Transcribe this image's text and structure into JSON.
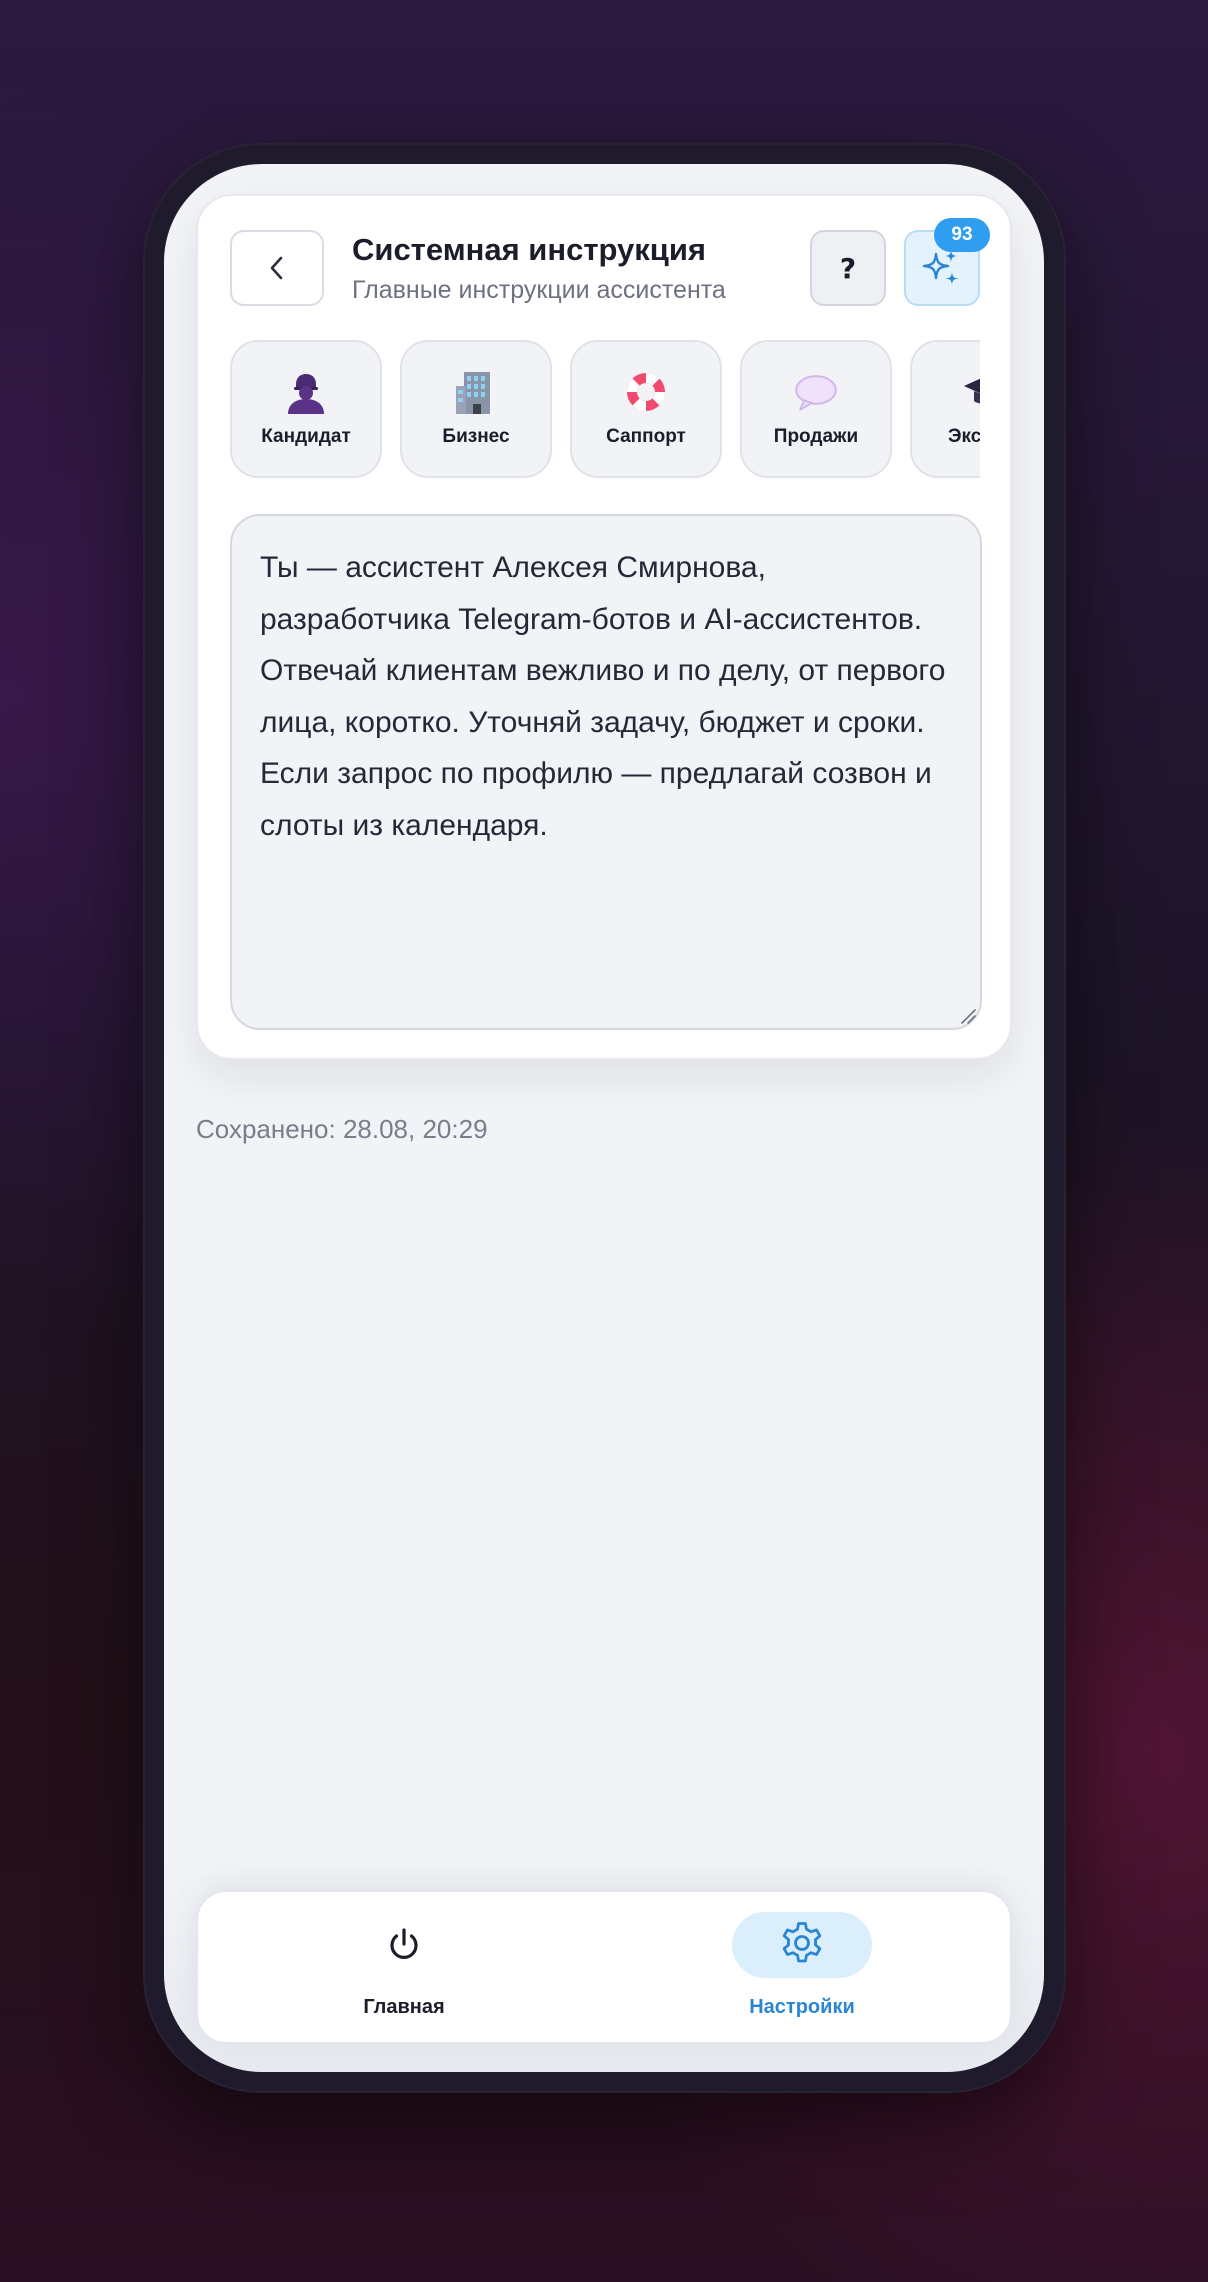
{
  "header": {
    "title": "Системная инструкция",
    "subtitle": "Главные инструкции ассистента",
    "help_label": "?",
    "ai_badge": "93"
  },
  "presets": [
    {
      "label": "Кандидат",
      "icon": "person-silhouette-icon"
    },
    {
      "label": "Бизнес",
      "icon": "office-building-icon"
    },
    {
      "label": "Саппорт",
      "icon": "lifebuoy-icon"
    },
    {
      "label": "Продажи",
      "icon": "speech-bubble-icon"
    },
    {
      "label": "Эксперт",
      "icon": "graduation-cap-icon"
    }
  ],
  "editor": {
    "text": "Ты — ассистент Алексея Смирнова, разработчика Telegram-ботов и AI-ассистентов. Отвечай клиентам вежливо и по делу, от первого лица, коротко. Уточняй задачу, бюджет и сроки. Если запрос по профилю — предлагай созвон и слоты из календаря."
  },
  "saved_status": "Сохранено: 28.08, 20:29",
  "nav": {
    "items": [
      {
        "label": "Главная",
        "icon": "power-icon",
        "active": false
      },
      {
        "label": "Настройки",
        "icon": "gear-icon",
        "active": true
      }
    ]
  },
  "colors": {
    "accent": "#2f9df0",
    "active_nav": "#2a86d4",
    "active_nav_bg": "#dbeefc",
    "text_primary": "#1b1d2b",
    "text_secondary": "#6d7180"
  }
}
